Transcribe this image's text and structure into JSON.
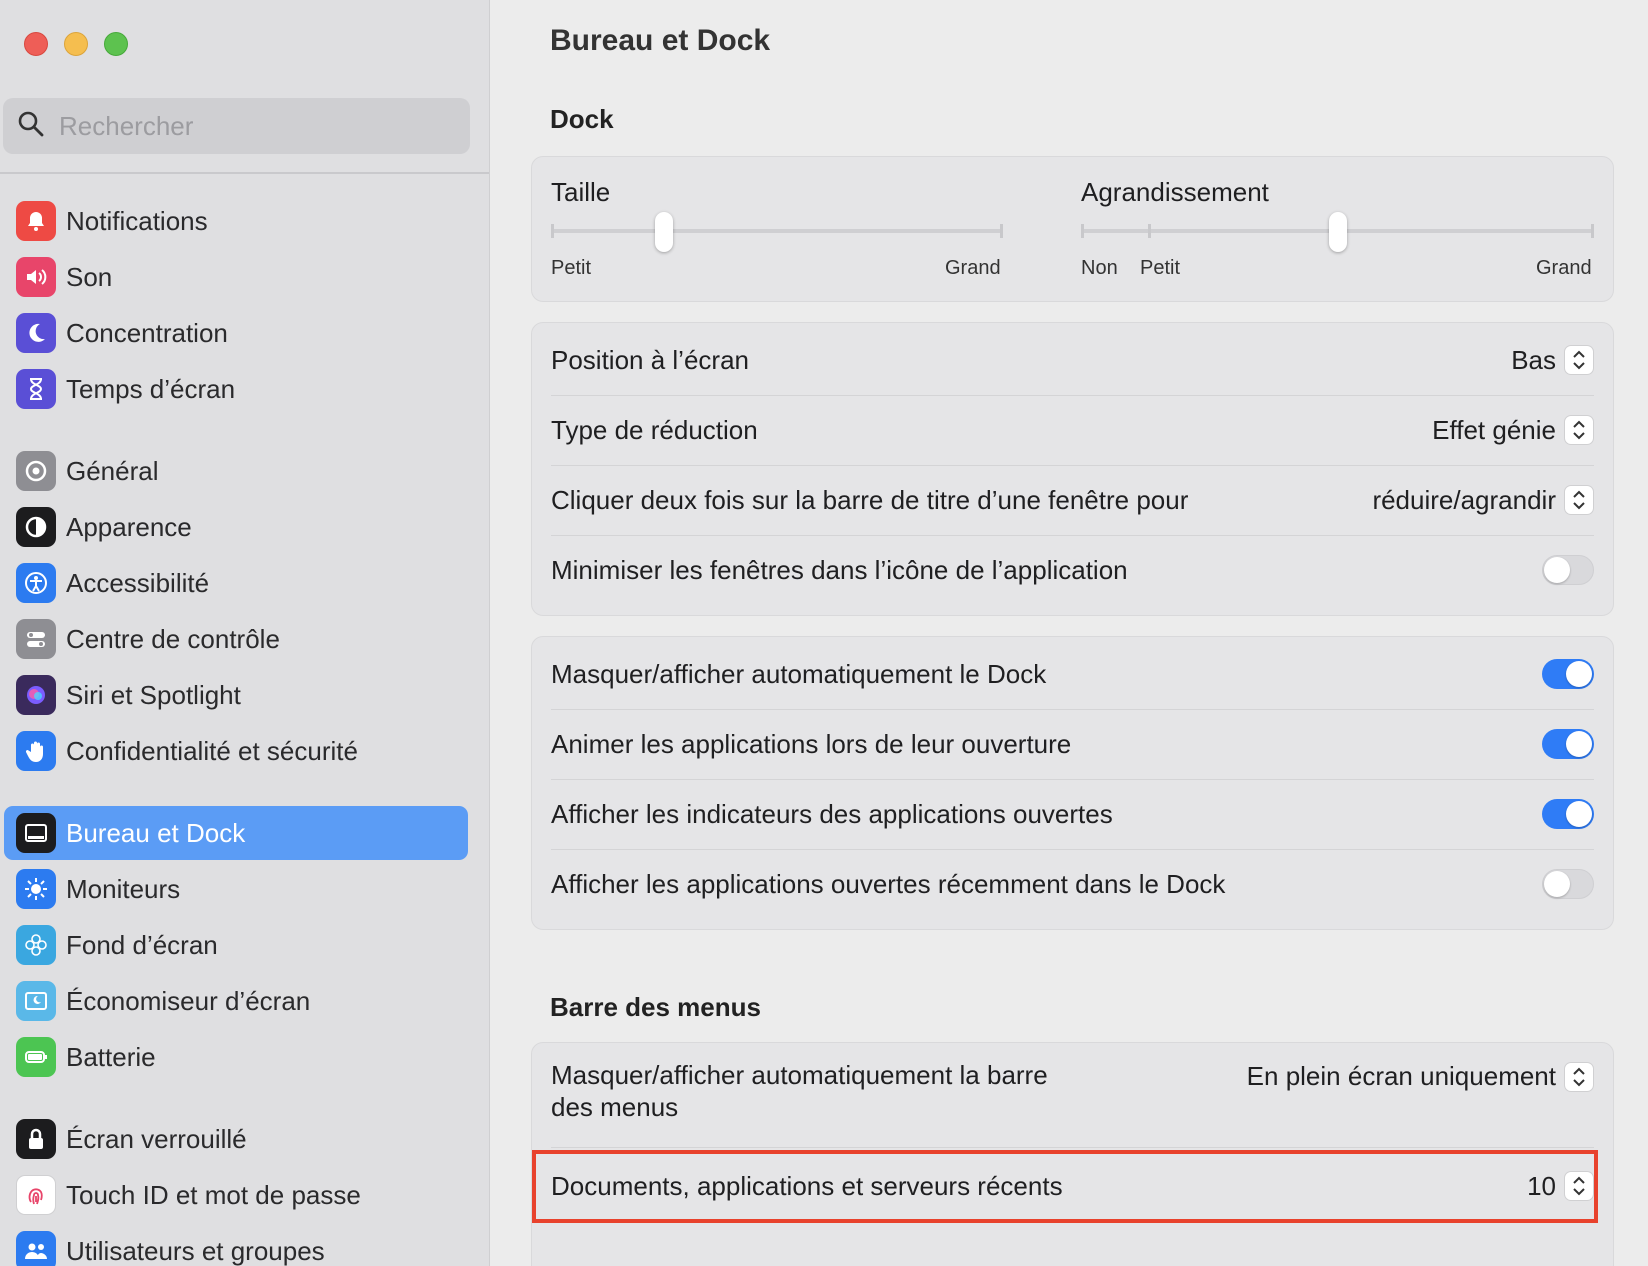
{
  "window": {
    "title": "Bureau et Dock"
  },
  "search": {
    "placeholder": "Rechercher"
  },
  "sidebar": {
    "items": [
      {
        "label": "Notifications",
        "icon": "bell-icon",
        "color": "#EE4A44"
      },
      {
        "label": "Son",
        "icon": "speaker-icon",
        "color": "#E8456A"
      },
      {
        "label": "Concentration",
        "icon": "moon-icon",
        "color": "#5A4FD6"
      },
      {
        "label": "Temps d’écran",
        "icon": "hourglass-icon",
        "color": "#5A4FD6"
      },
      {
        "label": "Général",
        "icon": "gear-icon",
        "color": "#8E8E93"
      },
      {
        "label": "Apparence",
        "icon": "appearance-icon",
        "color": "#1c1c1e"
      },
      {
        "label": "Accessibilité",
        "icon": "accessibility-icon",
        "color": "#2C7BF0"
      },
      {
        "label": "Centre de contrôle",
        "icon": "control-center-icon",
        "color": "#8E8E93"
      },
      {
        "label": "Siri et Spotlight",
        "icon": "siri-icon",
        "color": "#3a2a5c"
      },
      {
        "label": "Confidentialité et sécurité",
        "icon": "hand-icon",
        "color": "#2C7BF0"
      },
      {
        "label": "Bureau et Dock",
        "icon": "dock-icon",
        "color": "#1c1c1e",
        "selected": true
      },
      {
        "label": "Moniteurs",
        "icon": "sun-icon",
        "color": "#2C7BF0"
      },
      {
        "label": "Fond d’écran",
        "icon": "flower-icon",
        "color": "#3AA7E0"
      },
      {
        "label": "Économiseur d’écran",
        "icon": "screensaver-icon",
        "color": "#5AB8E8"
      },
      {
        "label": "Batterie",
        "icon": "battery-icon",
        "color": "#4CC552"
      },
      {
        "label": "Écran verrouillé",
        "icon": "lock-icon",
        "color": "#1c1c1e"
      },
      {
        "label": "Touch ID et mot de passe",
        "icon": "fingerprint-icon",
        "color": "#ffffff"
      },
      {
        "label": "Utilisateurs et groupes",
        "icon": "users-icon",
        "color": "#2C7BF0"
      }
    ]
  },
  "main": {
    "title": "Bureau et Dock",
    "dock_section": "Dock",
    "size_slider": {
      "label": "Taille",
      "min_label": "Petit",
      "max_label": "Grand",
      "value": 0.25
    },
    "magnification_slider": {
      "label": "Agrandissement",
      "off_label": "Non",
      "min_label": "Petit",
      "max_label": "Grand",
      "value": 0.5
    },
    "position": {
      "label": "Position à l’écran",
      "value": "Bas"
    },
    "minimize_effect": {
      "label": "Type de réduction",
      "value": "Effet génie"
    },
    "double_click": {
      "label": "Cliquer deux fois sur la barre de titre d’une fenêtre pour",
      "value": "réduire/agrandir"
    },
    "minimize_into_app": {
      "label": "Minimiser les fenêtres dans l’icône de l’application",
      "on": false
    },
    "autohide_dock": {
      "label": "Masquer/afficher automatiquement le Dock",
      "on": true
    },
    "animate_apps": {
      "label": "Animer les applications lors de leur ouverture",
      "on": true
    },
    "show_indicators": {
      "label": "Afficher les indicateurs des applications ouvertes",
      "on": true
    },
    "show_recent": {
      "label": "Afficher les applications ouvertes récemment dans le Dock",
      "on": false
    },
    "menubar_section": "Barre des menus",
    "autohide_menubar": {
      "label_line1": "Masquer/afficher automatiquement la barre",
      "label_line2": "des menus",
      "value": "En plein écran uniquement"
    },
    "recent_items": {
      "label": "Documents, applications et serveurs récents",
      "value": "10"
    }
  },
  "colors": {
    "accent": "#2F7CF6",
    "selection": "#5B9CF5",
    "highlight": "#E8422D"
  }
}
